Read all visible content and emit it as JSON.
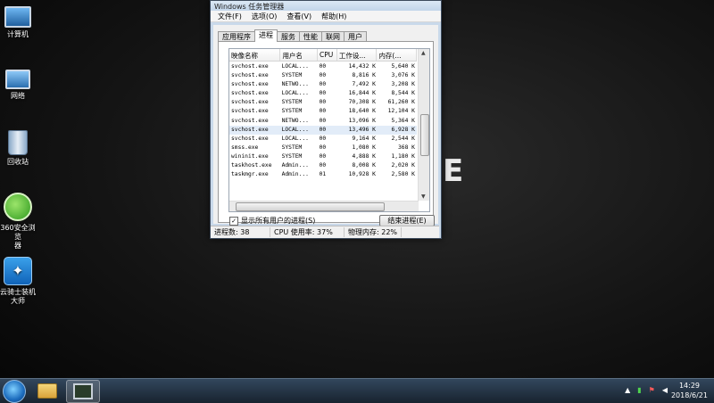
{
  "desktop": {
    "icons": [
      {
        "label": "计算机"
      },
      {
        "label": "网络"
      },
      {
        "label": "回收站"
      },
      {
        "label_line1": "360安全浏览",
        "label_line2": "器"
      },
      {
        "label_line1": "云骑士装机",
        "label_line2": "大师"
      }
    ]
  },
  "window": {
    "title": "Windows 任务管理器",
    "menu": [
      "文件(F)",
      "选项(O)",
      "查看(V)",
      "帮助(H)"
    ],
    "tabs": [
      "应用程序",
      "进程",
      "服务",
      "性能",
      "联网",
      "用户"
    ],
    "active_tab": "进程",
    "columns": [
      "映像名称",
      "用户名",
      "CPU",
      "工作设...",
      "内存(..."
    ],
    "processes": [
      [
        "svchost.exe",
        "LOCAL...",
        "00",
        "14,432 K",
        "5,640 K"
      ],
      [
        "svchost.exe",
        "SYSTEM",
        "00",
        "8,816 K",
        "3,076 K"
      ],
      [
        "svchost.exe",
        "NETWO...",
        "00",
        "7,492 K",
        "3,208 K"
      ],
      [
        "svchost.exe",
        "LOCAL...",
        "00",
        "16,844 K",
        "8,544 K"
      ],
      [
        "svchost.exe",
        "SYSTEM",
        "00",
        "70,308 K",
        "61,260 K"
      ],
      [
        "svchost.exe",
        "SYSTEM",
        "00",
        "18,640 K",
        "12,104 K"
      ],
      [
        "svchost.exe",
        "NETWO...",
        "00",
        "13,096 K",
        "5,364 K"
      ],
      [
        "svchost.exe",
        "LOCAL...",
        "00",
        "13,496 K",
        "6,928 K"
      ],
      [
        "svchost.exe",
        "LOCAL...",
        "00",
        "9,164 K",
        "2,544 K"
      ],
      [
        "smss.exe",
        "SYSTEM",
        "00",
        "1,080 K",
        "368 K"
      ],
      [
        "wininit.exe",
        "SYSTEM",
        "00",
        "4,888 K",
        "1,180 K"
      ],
      [
        "taskhost.exe",
        "Admin...",
        "00",
        "8,008 K",
        "2,020 K"
      ],
      [
        "taskmgr.exe",
        "Admin...",
        "01",
        "10,928 K",
        "2,580 K"
      ]
    ],
    "show_all_label": "显示所有用户的进程(S)",
    "show_all_checked": "✓",
    "end_process_label": "结束进程(E)",
    "status": {
      "processes": "进程数: 38",
      "cpu": "CPU 使用率: 37%",
      "memory": "物理内存: 22%"
    }
  },
  "taskbar": {
    "time": "14:29",
    "date": "2018/6/21"
  },
  "background_mark": "E"
}
